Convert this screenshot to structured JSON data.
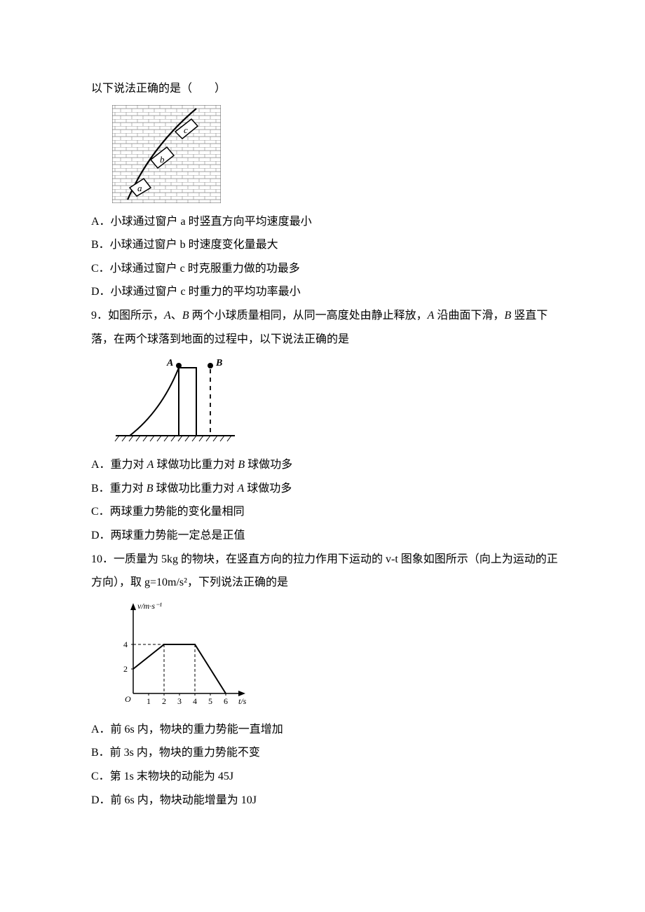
{
  "q8": {
    "stem": "以下说法正确的是（　　）",
    "options": {
      "A": "A．小球通过窗户 a 时竖直方向平均速度最小",
      "B": "B．小球通过窗户 b 时速度变化量最大",
      "C": "C．小球通过窗户 c 时克服重力做的功最多",
      "D": "D．小球通过窗户 c 时重力的平均功率最小"
    },
    "figure_labels": {
      "a": "a",
      "b": "b",
      "c": "c"
    }
  },
  "q9": {
    "stem_pre": "9．如图所示，",
    "stem_mid1": "A",
    "stem_mid2": "、",
    "stem_mid3": "B",
    "stem_mid4": " 两个小球质量相同，从同一高度处由静止释放，",
    "stem_mid5": "A",
    "stem_mid6": " 沿曲面下滑，",
    "stem_mid7": "B",
    "stem_mid8": " 竖直下落，在两个球落到地面的过程中，以下说法正确的是",
    "options": {
      "A_pre": "A．重力对 ",
      "A_i1": "A",
      "A_mid": " 球做功比重力对 ",
      "A_i2": "B",
      "A_post": " 球做功多",
      "B_pre": "B．重力对 ",
      "B_i1": "B",
      "B_mid": " 球做功比重力对 ",
      "B_i2": "A",
      "B_post": " 球做功多",
      "C": "C．两球重力势能的变化量相同",
      "D": "D．两球重力势能一定总是正值"
    },
    "figure_labels": {
      "A": "A",
      "B": "B"
    }
  },
  "q10": {
    "stem": "10．一质量为 5kg 的物块，在竖直方向的拉力作用下运动的 v-t 图象如图所示（向上为运动的正方向），取 g=10m/s²，下列说法正确的是",
    "options": {
      "A": "A．前 6s 内，物块的重力势能一直增加",
      "B": "B．前 3s 内，物块的重力势能不变",
      "C": "C．第 1s 末物块的动能为 45J",
      "D": "D．前 6s 内，物块动能增量为 10J"
    },
    "axis": {
      "ylabel": "v/m·s⁻¹",
      "xlabel": "t/s",
      "xticks": [
        "1",
        "2",
        "3",
        "4",
        "5",
        "6"
      ],
      "yticks": [
        "2",
        "4"
      ]
    }
  },
  "chart_data": {
    "type": "line",
    "title": "",
    "xlabel": "t/s",
    "ylabel": "v/m·s⁻¹",
    "x": [
      0,
      2,
      4,
      6
    ],
    "values": [
      2,
      4,
      4,
      0
    ],
    "xlim": [
      0,
      7
    ],
    "ylim": [
      0,
      5
    ],
    "grid": false,
    "annotations": [
      "dashed vertical at x=2 up to y=4",
      "dashed vertical at x=4 up to y=4",
      "dashed horizontal at y=4 from x=0 to x=2"
    ]
  }
}
